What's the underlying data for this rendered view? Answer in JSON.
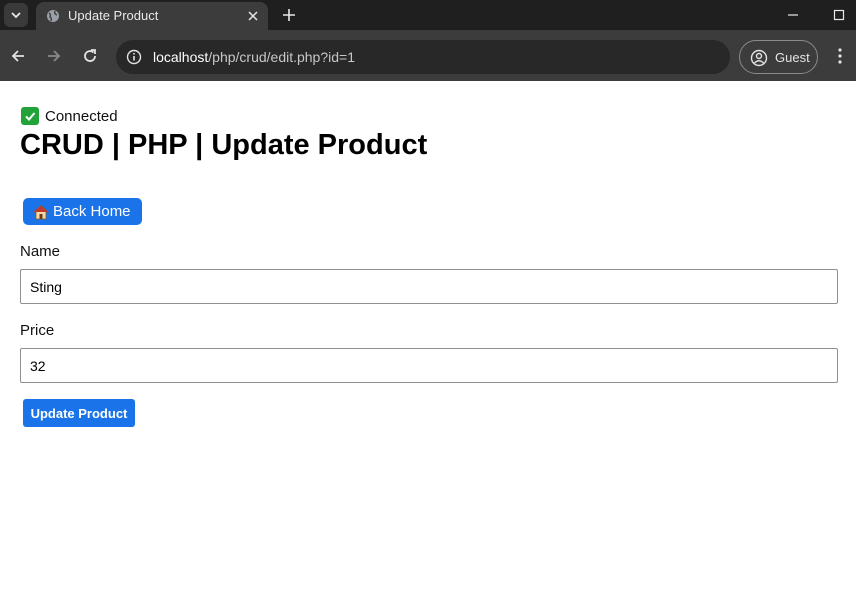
{
  "browser": {
    "tab_title": "Update Product",
    "url_host": "localhost",
    "url_path": "/php/crud/edit.php?id=1",
    "profile_label": "Guest"
  },
  "page": {
    "status_text": "Connected",
    "title": "CRUD | PHP | Update Product",
    "back_button_label": "Back Home",
    "form": {
      "name_label": "Name",
      "name_value": "Sting",
      "price_label": "Price",
      "price_value": "32",
      "submit_label": "Update Product"
    }
  },
  "colors": {
    "accent": "#1a73e8",
    "connected_check": "#22a33a"
  }
}
